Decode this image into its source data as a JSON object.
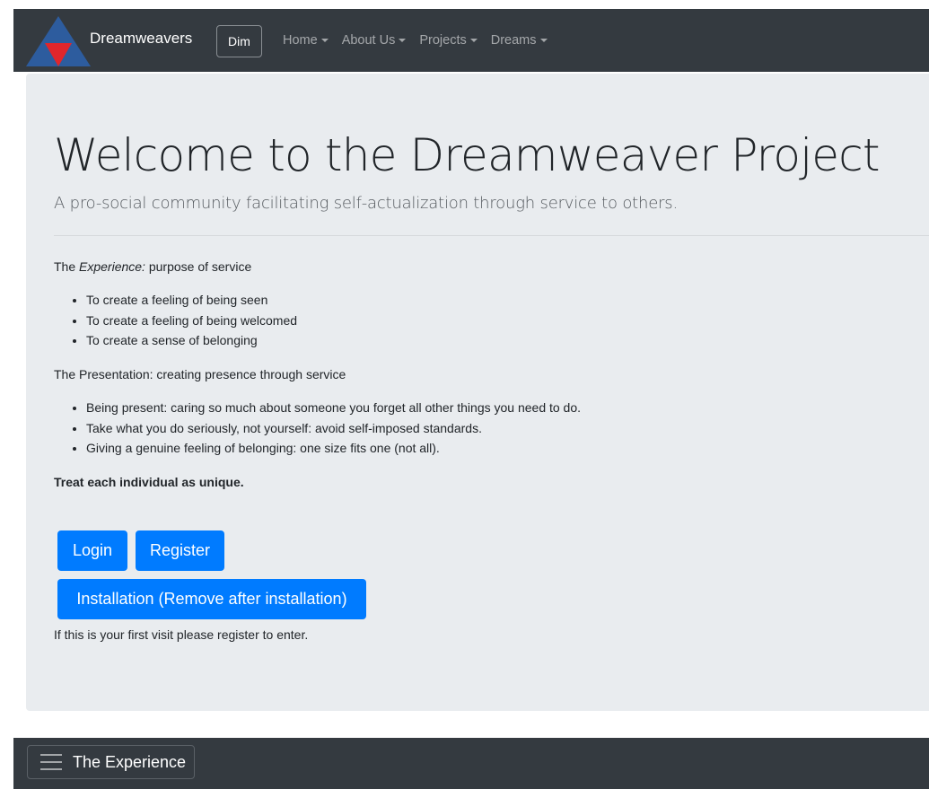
{
  "navbar": {
    "brand": "Dreamweavers",
    "dim_label": "Dim",
    "links": [
      {
        "label": "Home"
      },
      {
        "label": "About Us"
      },
      {
        "label": "Projects"
      },
      {
        "label": "Dreams"
      }
    ]
  },
  "jumbotron": {
    "title": "Welcome to the Dreamweaver Project",
    "lead": "A pro-social community facilitating self-actualization through service to others."
  },
  "experience": {
    "prefix": "The ",
    "emphasis": "Experience:",
    "suffix": " purpose of service",
    "items": [
      "To create a feeling of being seen",
      "To create a feeling of being welcomed",
      "To create a sense of belonging"
    ]
  },
  "presentation": {
    "heading": "The Presentation: creating presence through service",
    "items": [
      "Being present: caring so much about someone you forget all other things you need to do.",
      "Take what you do seriously, not yourself: avoid self-imposed standards.",
      "Giving a genuine feeling of belonging: one size fits one (not all)."
    ]
  },
  "motto": "Treat each individual as unique.",
  "buttons": {
    "login": "Login",
    "register": "Register",
    "installation": "Installation (Remove after installation)"
  },
  "first_visit_note": "If this is your first visit please register to enter.",
  "bottom_bar": {
    "label": "The Experience"
  },
  "colors": {
    "navbar_bg": "#343a40",
    "jumbotron_bg": "#e9ecef",
    "primary": "#007bff",
    "logo_blue": "#2d5c9e",
    "logo_red": "#e0262c"
  },
  "icons": {
    "logo": "triangle-logo-icon",
    "menu": "hamburger-menu-icon",
    "dropdown": "caret-down-icon"
  }
}
